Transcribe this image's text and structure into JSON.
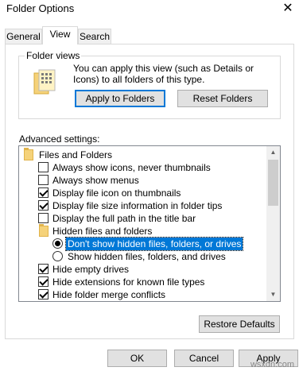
{
  "window": {
    "title": "Folder Options",
    "close_glyph": "✕"
  },
  "tabs": [
    {
      "label": "General",
      "active": false
    },
    {
      "label": "View",
      "active": true
    },
    {
      "label": "Search",
      "active": false
    }
  ],
  "folder_views": {
    "title": "Folder views",
    "icon": "folder-views-icon",
    "description": "You can apply this view (such as Details or Icons) to all folders of this type.",
    "apply_label": "Apply to Folders",
    "reset_label": "Reset Folders"
  },
  "advanced": {
    "label": "Advanced settings:",
    "items": [
      {
        "kind": "folder",
        "label": "Files and Folders"
      },
      {
        "kind": "checkbox",
        "label": "Always show icons, never thumbnails",
        "checked": false
      },
      {
        "kind": "checkbox",
        "label": "Always show menus",
        "checked": false
      },
      {
        "kind": "checkbox",
        "label": "Display file icon on thumbnails",
        "checked": true
      },
      {
        "kind": "checkbox",
        "label": "Display file size information in folder tips",
        "checked": true
      },
      {
        "kind": "checkbox",
        "label": "Display the full path in the title bar",
        "checked": false
      },
      {
        "kind": "folder",
        "label": "Hidden files and folders"
      },
      {
        "kind": "radio",
        "label": "Don't show hidden files, folders, or drives",
        "checked": true,
        "selected": true
      },
      {
        "kind": "radio",
        "label": "Show hidden files, folders, and drives",
        "checked": false
      },
      {
        "kind": "checkbox",
        "label": "Hide empty drives",
        "checked": true
      },
      {
        "kind": "checkbox",
        "label": "Hide extensions for known file types",
        "checked": true
      },
      {
        "kind": "checkbox",
        "label": "Hide folder merge conflicts",
        "checked": true
      }
    ],
    "restore_label": "Restore Defaults"
  },
  "footer": {
    "ok_label": "OK",
    "cancel_label": "Cancel",
    "apply_label": "Apply"
  },
  "watermark": "wsxdn.com",
  "colors": {
    "selection": "#0078d7",
    "default_button_border": "#0078d7",
    "folder": "#f5d27a"
  }
}
